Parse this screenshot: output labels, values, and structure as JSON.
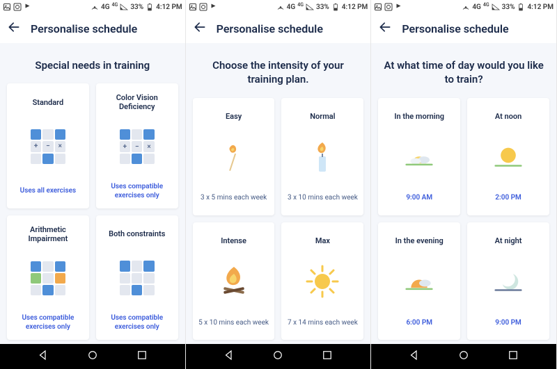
{
  "statusbar": {
    "network_label": "4G",
    "network_sup": "4G",
    "battery_percent": "33%",
    "clock": "4:12 PM"
  },
  "header": {
    "title": "Personalise schedule"
  },
  "screens": [
    {
      "heading": "Special needs in training",
      "cards": [
        {
          "title": "Standard",
          "caption": "Uses all exercises",
          "icon": "grid-standard"
        },
        {
          "title": "Color Vision Deficiency",
          "caption": "Uses compatible exercises only",
          "icon": "grid-cvd"
        },
        {
          "title": "Arithmetic Impairment",
          "caption": "Uses compatible exercises only",
          "icon": "grid-arith"
        },
        {
          "title": "Both constraints",
          "caption": "Uses compatible exercises only",
          "icon": "grid-both"
        }
      ]
    },
    {
      "heading": "Choose the intensity of your training plan.",
      "cards": [
        {
          "title": "Easy",
          "caption": "3 x 5 mins each week",
          "icon": "match"
        },
        {
          "title": "Normal",
          "caption": "3 x 10 mins each week",
          "icon": "candle"
        },
        {
          "title": "Intense",
          "caption": "5 x 10 mins each week",
          "icon": "bonfire"
        },
        {
          "title": "Max",
          "caption": "7 x 14 mins each week",
          "icon": "sun"
        }
      ]
    },
    {
      "heading": "At what time of day would you like to train?",
      "cards": [
        {
          "title": "In the morning",
          "caption": "9:00 AM",
          "icon": "sunrise"
        },
        {
          "title": "At noon",
          "caption": "2:00 PM",
          "icon": "noon"
        },
        {
          "title": "In the evening",
          "caption": "6:00 PM",
          "icon": "sunset"
        },
        {
          "title": "At night",
          "caption": "9:00 PM",
          "icon": "moon"
        }
      ]
    }
  ]
}
